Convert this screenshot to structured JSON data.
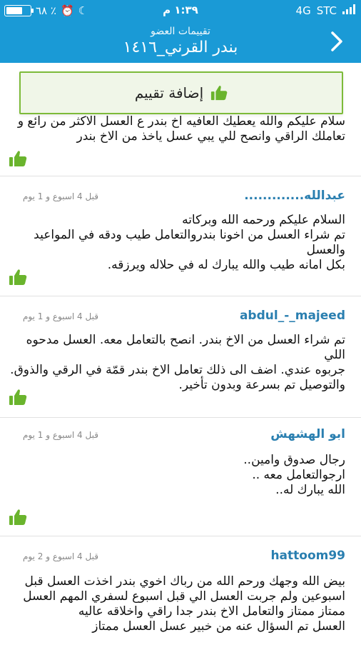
{
  "status_bar": {
    "battery": "٦٨ ٪",
    "time": "١:٣٩ م",
    "network": "4G",
    "carrier": "STC"
  },
  "header": {
    "subtitle": "تقييمات العضو",
    "title": "بندر القرني_١٤١٦"
  },
  "add_rating_label": "إضافة تقييم",
  "first_review_body": "سلام عليكم والله يعطيك العافيه اخ بندر ع العسل الاكثر من رائع و\nتعاملك الراقي وانصح للي يبي عسل ياخذ من الاخ بندر",
  "reviews": [
    {
      "name": "عبدالله.............",
      "date": "قبل 4 اسبوع و 1 يوم",
      "body": "السلام عليكم ورحمه الله وبركاته\nتم شراء العسل من اخونا بندروالتعامل طيب ودقه في المواعيد والعسل\nبكل امانه طيب والله يبارك له في حلاله ويرزقه."
    },
    {
      "name": "abdul_-_majeed",
      "date": "قبل 4 اسبوع و 1 يوم",
      "body": "تم شراء العسل من الاخ بندر. انصح بالتعامل معه. العسل مدحوه اللي\nجربوه عندي. اضف الى ذلك تعامل الاخ بندر قمّة في الرقي والذوق.\nوالتوصيل تم بسرعة وبدون تأخير."
    },
    {
      "name": "ابو الهشهش",
      "date": "قبل 4 اسبوع و 1 يوم",
      "body": "رجال صدوق وامين..\nارجوالتعامل معه ..\nالله يبارك له.."
    },
    {
      "name": "hattoom99",
      "date": "قبل 4 اسبوع و 2 يوم",
      "body": "بيض الله وجهك ورحم الله من رباك اخوي بندر اخذت العسل قبل\nاسبوعين ولم جربت العسل الي قبل اسبوع لسفري المهم العسل\nممتاز ممتاز والتعامل الاخ بندر جدا راقي واخلاقه عاليه\nالعسل تم السؤال عنه من خبير عسل العسل ممتاز"
    }
  ],
  "colors": {
    "header_blue": "#1a9ad6",
    "like_green": "#6ab42d",
    "name_blue": "#2a7fb0"
  },
  "icons": {
    "back": "chevron-right-icon",
    "like": "thumbs-up-icon"
  }
}
